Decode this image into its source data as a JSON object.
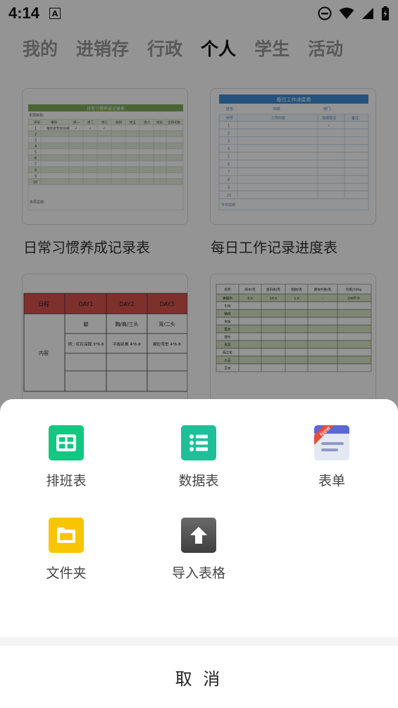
{
  "status_bar": {
    "time": "4:14",
    "notification_badge": "A"
  },
  "tabs": [
    {
      "label": "我的",
      "active": false
    },
    {
      "label": "进销存",
      "active": false
    },
    {
      "label": "行政",
      "active": false
    },
    {
      "label": "个人",
      "active": true
    },
    {
      "label": "学生",
      "active": false
    },
    {
      "label": "活动",
      "active": false
    }
  ],
  "templates": [
    {
      "title": "日常习惯养成记录表",
      "sheet_title": "日常习惯养成记录表",
      "sub_label": "本周目标:",
      "headers": [
        "序号",
        "事项",
        "周一",
        "周二",
        "周三",
        "周四",
        "周五",
        "周六",
        "周日",
        "坚持天数"
      ],
      "first_row": [
        "1",
        "每天读书30分钟",
        "✓",
        "✓",
        "✓"
      ],
      "rows": [
        "2",
        "3",
        "4",
        "5",
        "6",
        "7",
        "8",
        "9",
        "10"
      ],
      "footer": "本周总结:"
    },
    {
      "title": "每日工作记录进度表",
      "sheet_title": "每日工作进度表",
      "info": [
        "姓名:",
        "日期:",
        "部门:"
      ],
      "headers": [
        "序号",
        "工作内容",
        "完成情况",
        "备注"
      ],
      "rows": [
        "1",
        "2",
        "3",
        "4",
        "5",
        "6",
        "7",
        "8",
        "9",
        "10"
      ],
      "footer": "今日总结"
    },
    {
      "title": "",
      "headers": [
        "日程",
        "DAY1",
        "DAY2",
        "DAY3"
      ],
      "row_label": "内容",
      "cells": [
        "腿",
        "胸/肩/三头",
        "背/二头",
        "例：杠铃深蹲 3*6-8",
        "平板卧推 4*6-8",
        "硬拉弯举 4*6-8"
      ]
    },
    {
      "title": "",
      "headers": [
        "名称",
        "碳水/克",
        "蛋白质/克",
        "脂肪/克",
        "膳食纤维/克",
        "热量/100g"
      ],
      "first_row": [
        "猪瘦肉",
        "0.0",
        "24.6",
        "1.9",
        "-",
        "106千卡"
      ],
      "rows": [
        "牛肉",
        "猪肉",
        "米饭",
        "面条",
        "馒头",
        "青菜",
        "西兰花",
        "土豆",
        "玉米"
      ]
    }
  ],
  "sheet": {
    "options": [
      {
        "label": "排班表",
        "icon": "schedule-grid-icon",
        "color": "#12c781"
      },
      {
        "label": "数据表",
        "icon": "data-list-icon",
        "color": "#1fbf9a"
      },
      {
        "label": "表单",
        "icon": "form-icon",
        "badge": "New",
        "color": "#5b67d6"
      },
      {
        "label": "文件夹",
        "icon": "folder-icon",
        "color": "#f7c600"
      },
      {
        "label": "导入表格",
        "icon": "upload-arrow-icon",
        "color": "#555555"
      }
    ],
    "cancel_label": "取 消"
  }
}
